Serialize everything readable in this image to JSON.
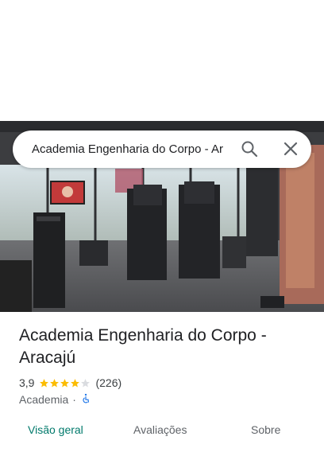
{
  "search": {
    "query": "Academia Engenharia do Corpo - Ar",
    "search_icon": "search-icon",
    "close_icon": "close-icon"
  },
  "photo": {
    "subject": "gym-interior-photo"
  },
  "place": {
    "name": "Academia Engenharia do Corpo - Aracajú",
    "rating_value": "3,9",
    "rating_stars": 3.9,
    "review_count": "(226)",
    "category": "Academia",
    "separator": "·",
    "accessibility_icon": "wheelchair-icon"
  },
  "tabs": [
    {
      "label": "Visão geral",
      "active": true
    },
    {
      "label": "Avaliações",
      "active": false
    },
    {
      "label": "Sobre",
      "active": false
    }
  ],
  "colors": {
    "star_filled": "#fbbc04",
    "star_empty": "#dadce0",
    "active_tab": "#00796b",
    "accessibility_icon": "#1a73e8"
  }
}
